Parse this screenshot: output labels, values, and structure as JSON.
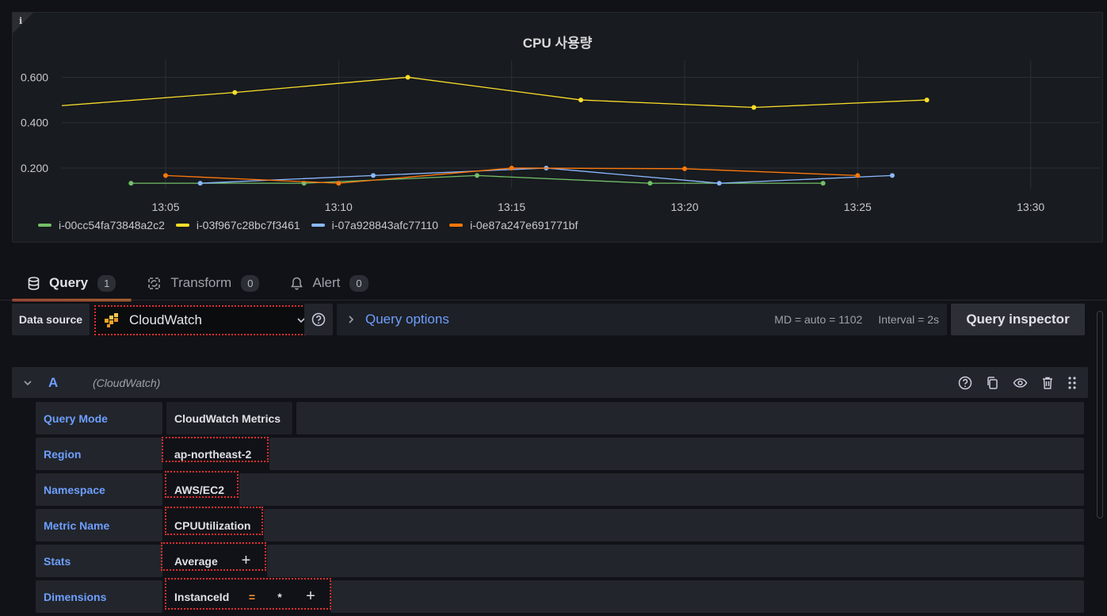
{
  "panel": {
    "title": "CPU 사용량",
    "info_icon": "info-icon"
  },
  "chart_data": {
    "type": "line",
    "title": "CPU 사용량",
    "xlabel": "",
    "ylabel": "",
    "x_ticks": [
      "13:05",
      "13:10",
      "13:15",
      "13:20",
      "13:25",
      "13:30"
    ],
    "y_ticks": [
      "0.200",
      "0.400",
      "0.600"
    ],
    "xlim": [
      "13:02",
      "13:32"
    ],
    "ylim": [
      0.13,
      0.64
    ],
    "grid": true,
    "legend_position": "bottom-left",
    "series": [
      {
        "name": "i-00cc54fa73848a2c2",
        "color": "#73bf69",
        "points": [
          [
            "13:04",
            0.133
          ],
          [
            "13:09",
            0.133
          ],
          [
            "13:14",
            0.167
          ],
          [
            "13:19",
            0.133
          ],
          [
            "13:24",
            0.133
          ]
        ]
      },
      {
        "name": "i-03f967c28bc7f3461",
        "color": "#fade2a",
        "points": [
          [
            "13:02",
            0.475
          ],
          [
            "13:07",
            0.533
          ],
          [
            "13:12",
            0.6
          ],
          [
            "13:17",
            0.5
          ],
          [
            "13:22",
            0.467
          ],
          [
            "13:27",
            0.5
          ]
        ]
      },
      {
        "name": "i-07a928843afc77110",
        "color": "#8ab8ff",
        "points": [
          [
            "13:06",
            0.133
          ],
          [
            "13:11",
            0.167
          ],
          [
            "13:16",
            0.2
          ],
          [
            "13:21",
            0.133
          ],
          [
            "13:26",
            0.167
          ]
        ]
      },
      {
        "name": "i-0e87a247e691771bf",
        "color": "#ff780a",
        "points": [
          [
            "13:05",
            0.167
          ],
          [
            "13:10",
            0.133
          ],
          [
            "13:15",
            0.2
          ],
          [
            "13:20",
            0.197
          ],
          [
            "13:25",
            0.167
          ]
        ]
      }
    ]
  },
  "tabs": [
    {
      "label": "Query",
      "count": "1",
      "icon": "database-icon"
    },
    {
      "label": "Transform",
      "count": "0",
      "icon": "transform-icon"
    },
    {
      "label": "Alert",
      "count": "0",
      "icon": "bell-icon"
    }
  ],
  "toolbar": {
    "data_source_label": "Data source",
    "data_source_value": "CloudWatch",
    "query_options_label": "Query options",
    "md_info": "MD = auto = 1102",
    "interval_info": "Interval = 2s",
    "inspector_label": "Query inspector"
  },
  "query": {
    "ref_id": "A",
    "datasource_name": "(CloudWatch)",
    "rows": {
      "query_mode": {
        "label": "Query Mode",
        "value": "CloudWatch Metrics"
      },
      "region": {
        "label": "Region",
        "value": "ap-northeast-2"
      },
      "namespace": {
        "label": "Namespace",
        "value": "AWS/EC2"
      },
      "metric_name": {
        "label": "Metric Name",
        "value": "CPUUtilization"
      },
      "stats": {
        "label": "Stats",
        "value": "Average",
        "add": "+"
      },
      "dimensions": {
        "label": "Dimensions",
        "key": "InstanceId",
        "operator": "=",
        "value": "*",
        "add": "+"
      }
    }
  },
  "colors": {
    "accent_blue": "#6e9fff",
    "highlight_red": "#e02f2f",
    "tab_underline": "#ff8833"
  }
}
